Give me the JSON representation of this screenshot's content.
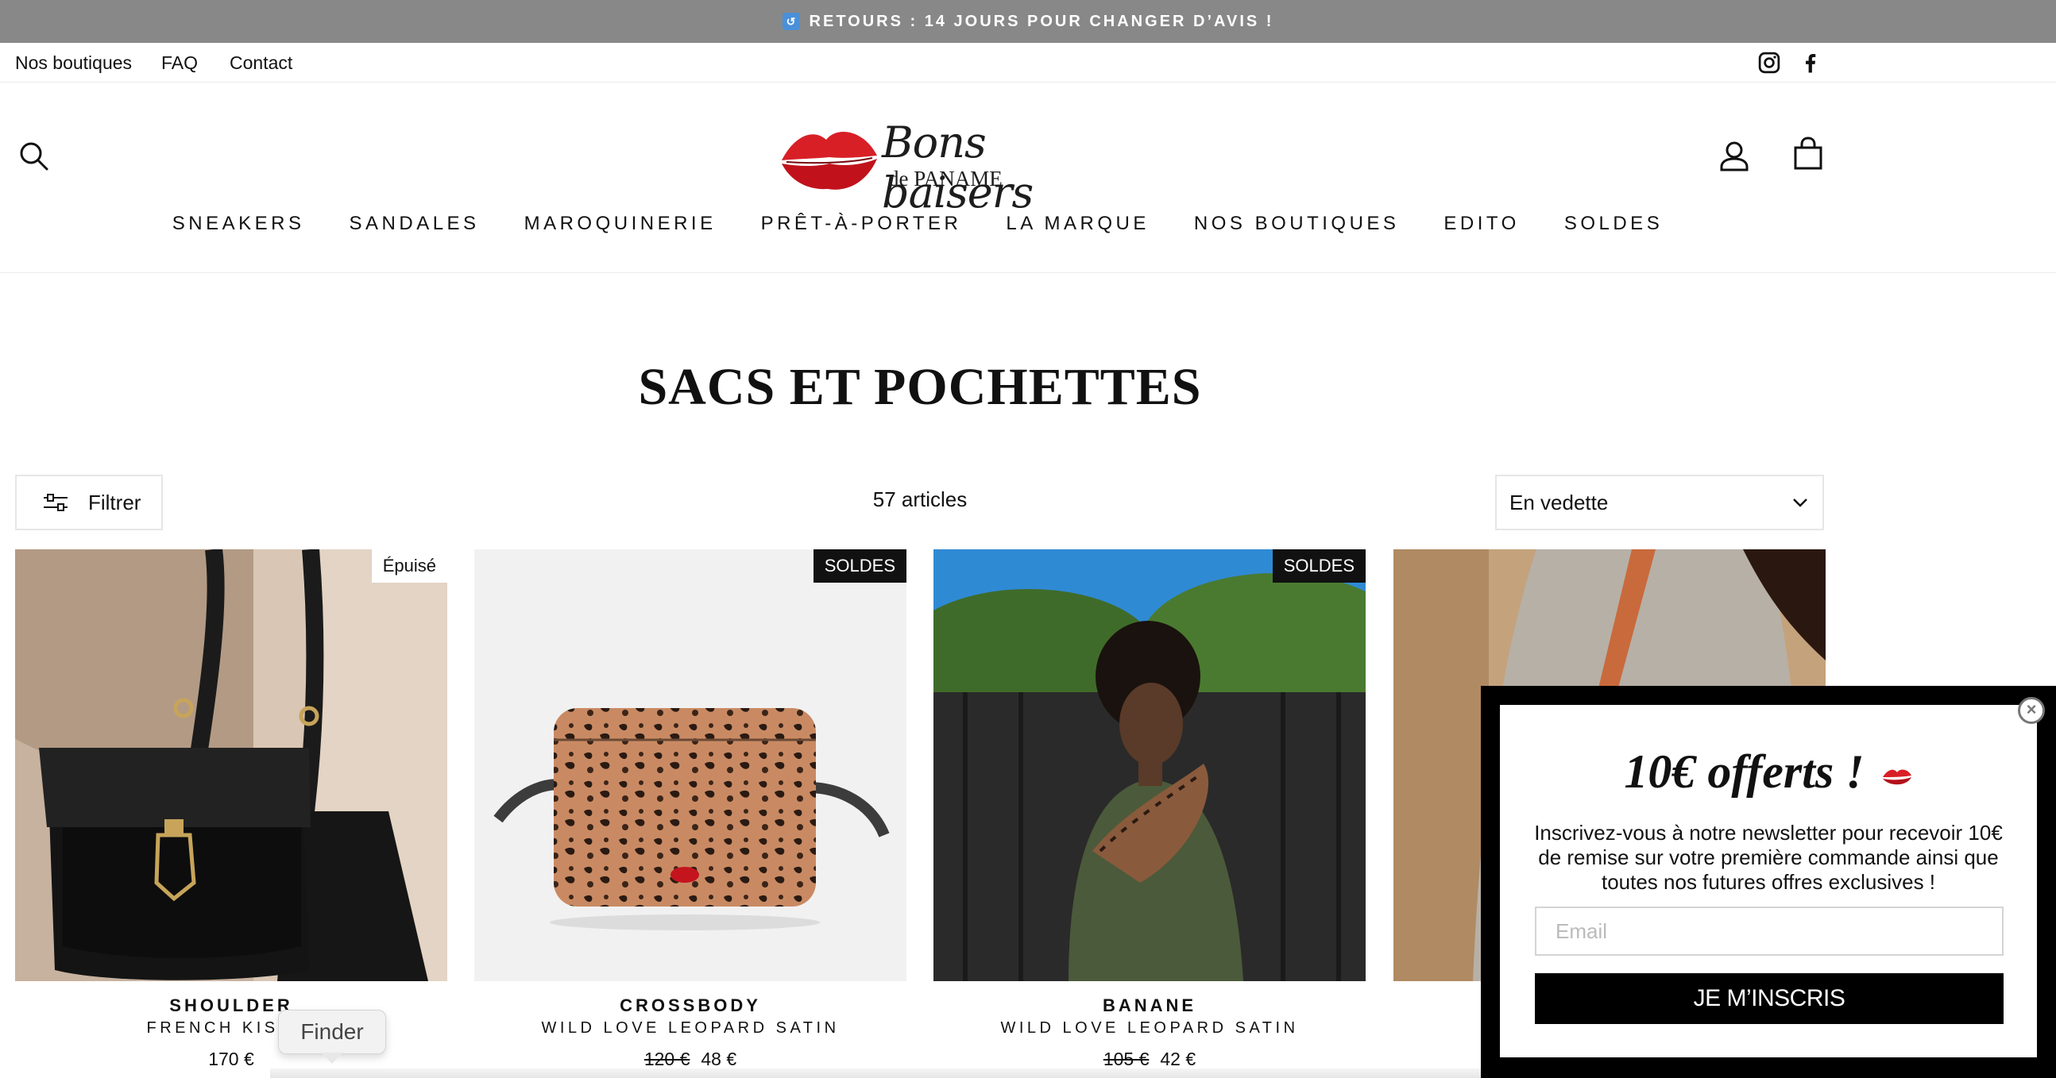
{
  "announcement": {
    "icon": "return-arrow-icon",
    "text": "RETOURS : 14 JOURS POUR CHANGER D’AVIS !"
  },
  "utility_nav": {
    "links": [
      "Nos boutiques",
      "FAQ",
      "Contact"
    ],
    "social": [
      "instagram-icon",
      "facebook-icon"
    ]
  },
  "header": {
    "logo": {
      "line1": "Bons baisers",
      "line2": "de PANAME"
    },
    "nav": [
      "SNEAKERS",
      "SANDALES",
      "MAROQUINERIE",
      "PRÊT-À-PORTER",
      "LA MARQUE",
      "NOS BOUTIQUES",
      "EDITO",
      "SOLDES"
    ],
    "icons": [
      "search-icon",
      "account-icon",
      "cart-icon"
    ],
    "accent_color": "#d81f26"
  },
  "collection": {
    "title": "SACS ET POCHETTES",
    "filter_label": "Filtrer",
    "count": "57 articles",
    "sort_selected": "En vedette"
  },
  "products": [
    {
      "badge": "Épuisé",
      "name": "SHOULDER",
      "variant": "FRENCH KISS N",
      "price": "170 €",
      "old_price": ""
    },
    {
      "badge": "SOLDES",
      "name": "CROSSBODY",
      "variant": "WILD LOVE LEOPARD SATIN",
      "price": "48 €",
      "old_price": "120 €"
    },
    {
      "badge": "SOLDES",
      "name": "BANANE",
      "variant": "WILD LOVE LEOPARD SATIN",
      "price": "42 €",
      "old_price": "105 €"
    },
    {
      "badge": "",
      "name": "",
      "variant": "",
      "price": "",
      "old_price": ""
    }
  ],
  "finder_tooltip": "Finder",
  "popup": {
    "title": "10€ offerts !",
    "body": "Inscrivez-vous à notre newsletter pour recevoir 10€ de remise sur votre première commande ainsi que toutes nos futures offres exclusives !",
    "email_placeholder": "Email",
    "button": "JE M’INSCRIS"
  }
}
